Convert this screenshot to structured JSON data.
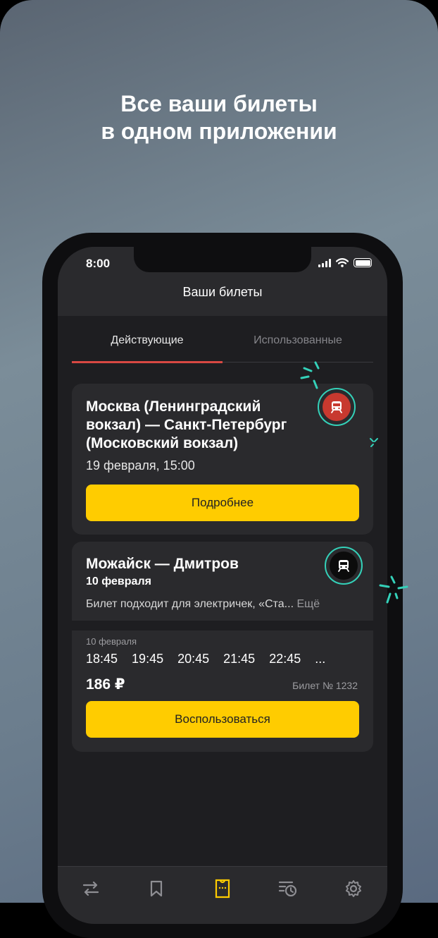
{
  "promo": {
    "headline_line1": "Все ваши билеты",
    "headline_line2": "в одном приложении"
  },
  "status_bar": {
    "time": "8:00"
  },
  "screen": {
    "title": "Ваши билеты",
    "tabs": [
      {
        "label": "Действующие",
        "active": true
      },
      {
        "label": "Использованные",
        "active": false
      }
    ]
  },
  "tickets": [
    {
      "route": "Москва (Ленинградский вокзал) — Санкт-Петербург (Московский вокзал)",
      "datetime": "19 февраля, 15:00",
      "button_label": "Подробнее",
      "icon": "train-icon"
    },
    {
      "route": "Можайск — Дмитров",
      "date": "10 февраля",
      "description": "Билет подходит для электричек, «Ста...",
      "more_label": "Ещё",
      "schedule_date": "10 февраля",
      "times": [
        "18:45",
        "19:45",
        "20:45",
        "21:45",
        "22:45",
        "..."
      ],
      "price": "186 ₽",
      "ticket_number": "Билет № 1232",
      "button_label": "Воспользоваться",
      "icon": "train-icon"
    }
  ],
  "bottom_nav": [
    "routes-icon",
    "bookmark-icon",
    "ticket-icon",
    "history-icon",
    "settings-icon"
  ],
  "colors": {
    "accent_yellow": "#ffcc00",
    "tab_underline": "#d84842",
    "badge_red": "#c8392f",
    "sparkle_teal": "#34d1b9",
    "active_nav": "#ffcc00"
  }
}
